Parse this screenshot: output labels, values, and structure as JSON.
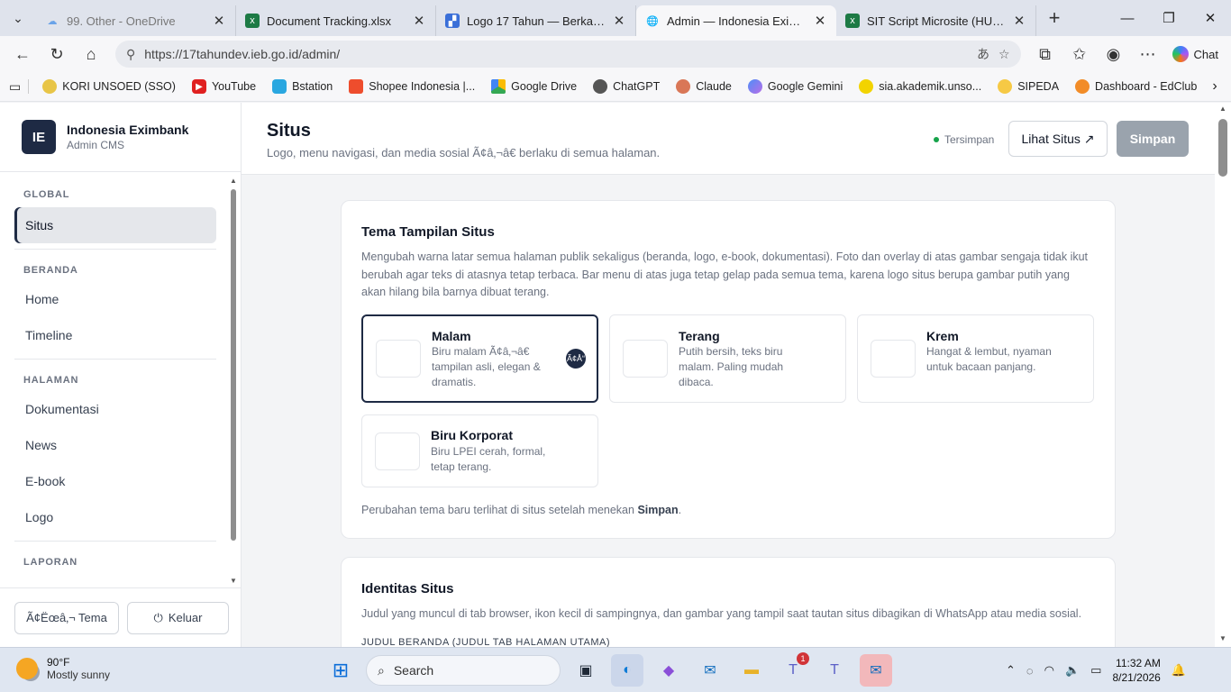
{
  "browser": {
    "tabs": [
      {
        "title": "99. Other - OneDrive",
        "icon": "onedrive-icon",
        "dim": true
      },
      {
        "title": "Document Tracking.xlsx",
        "icon": "excel-icon"
      },
      {
        "title": "Logo 17 Tahun — Berkarya, Ber",
        "icon": "doc-icon"
      },
      {
        "title": "Admin — Indonesia Eximbank",
        "icon": "globe-icon",
        "active": true
      },
      {
        "title": "SIT Script Microsite (HUT 17 LP",
        "icon": "excel-icon"
      }
    ],
    "url": "https://17tahundev.ieb.go.id/admin/",
    "chat_label": "Chat",
    "bookmarks": [
      "KORI UNSOED (SSO)",
      "YouTube",
      "Bstation",
      "Shopee Indonesia |...",
      "Google Drive",
      "ChatGPT",
      "Claude",
      "Google Gemini",
      "sia.akademik.unso...",
      "SIPEDA",
      "Dashboard - EdClub"
    ]
  },
  "sidebar": {
    "logo_text": "IE",
    "brand_name": "Indonesia Eximbank",
    "brand_sub": "Admin CMS",
    "groups": {
      "global": "GLOBAL",
      "beranda": "BERANDA",
      "halaman": "HALAMAN",
      "laporan": "LAPORAN"
    },
    "items": {
      "situs": "Situs",
      "home": "Home",
      "timeline": "Timeline",
      "dokumentasi": "Dokumentasi",
      "news": "News",
      "ebook": "E-book",
      "logo": "Logo"
    },
    "footer": {
      "theme_label": "Ã¢Ëœâ‚¬ Tema",
      "logout_label": "Keluar"
    }
  },
  "header": {
    "title": "Situs",
    "subtitle": "Logo, menu navigasi, dan media sosial Ã¢â‚¬â€ berlaku di semua halaman.",
    "status": "Tersimpan",
    "view_button": "Lihat Situs ↗",
    "save_button": "Simpan"
  },
  "theme_card": {
    "title": "Tema Tampilan Situs",
    "description": "Mengubah warna latar semua halaman publik sekaligus (beranda, logo, e-book, dokumentasi). Foto dan overlay di atas gambar sengaja tidak ikut berubah agar teks di atasnya tetap terbaca. Bar menu di atas juga tetap gelap pada semua tema, karena logo situs berupa gambar putih yang akan hilang bila barnya dibuat terang.",
    "options": [
      {
        "name": "Malam",
        "desc": "Biru malam Ã¢â‚¬â€ tampilan asli, elegan & dramatis.",
        "selected": true
      },
      {
        "name": "Terang",
        "desc": "Putih bersih, teks biru malam. Paling mudah dibaca."
      },
      {
        "name": "Krem",
        "desc": "Hangat & lembut, nyaman untuk bacaan panjang."
      },
      {
        "name": "Biru Korporat",
        "desc": "Biru LPEI cerah, formal, tetap terang."
      }
    ],
    "check_text": "Ã¢Å“",
    "note_prefix": "Perubahan tema baru terlihat di situs setelah menekan ",
    "note_bold": "Simpan",
    "note_suffix": "."
  },
  "identity_card": {
    "title": "Identitas Situs",
    "description": "Judul yang muncul di tab browser, ikon kecil di sampingnya, dan gambar yang tampil saat tautan situs dibagikan di WhatsApp atau media sosial.",
    "field_label": "JUDUL BERANDA (JUDUL TAB HALAMAN UTAMA)"
  },
  "taskbar": {
    "temp": "90°F",
    "weather": "Mostly sunny",
    "search_placeholder": "Search",
    "time": "11:32 AM",
    "date": "8/21/2026",
    "teams_badge": "1"
  }
}
